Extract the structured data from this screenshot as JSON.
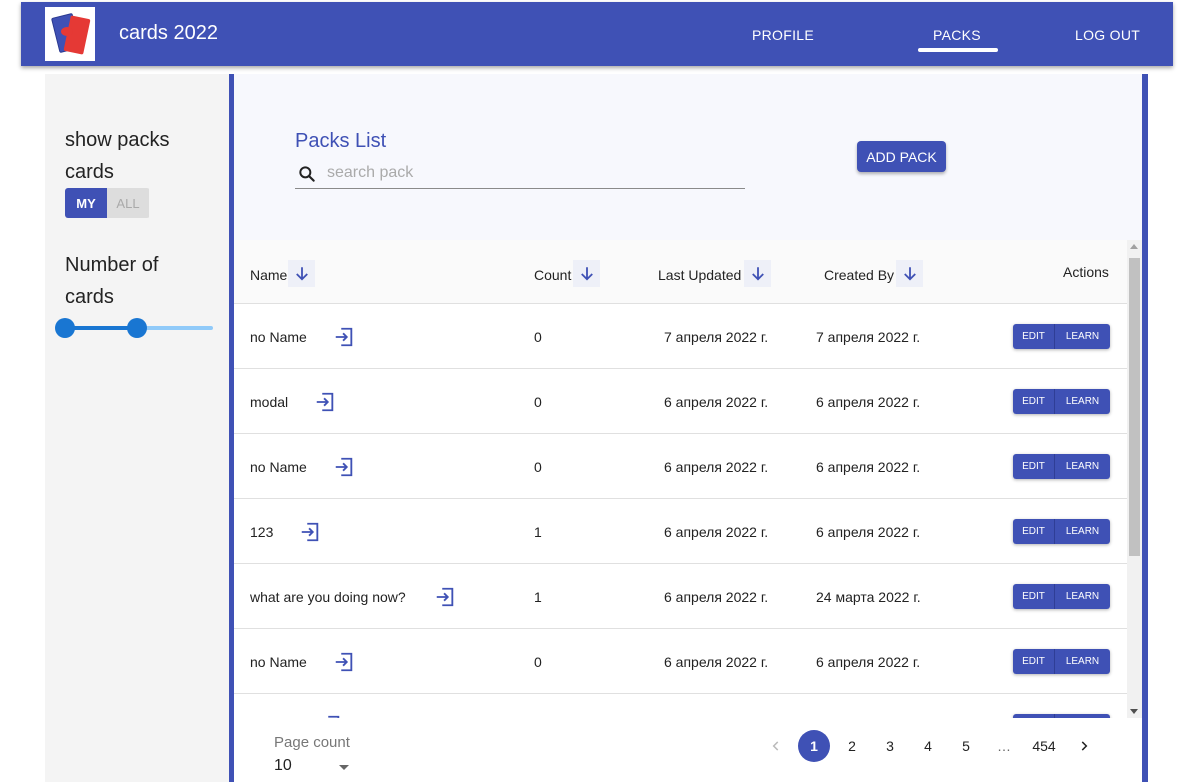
{
  "header": {
    "title": "cards 2022",
    "nav": [
      "PROFILE",
      "PACKS",
      "LOG OUT"
    ],
    "active_nav": "PACKS"
  },
  "sidebar": {
    "show_label_line1": "show packs",
    "show_label_line2": "cards",
    "toggle": {
      "my": "MY",
      "all": "ALL",
      "selected": "MY"
    },
    "number_label_line1": "Number of",
    "number_label_line2": "cards"
  },
  "main": {
    "title": "Packs List",
    "search_placeholder": "search pack",
    "search_value": "",
    "add_pack_label": "ADD PACK"
  },
  "table": {
    "headers": {
      "name": "Name",
      "count": "Count",
      "updated": "Last Updated",
      "created": "Created By",
      "actions": "Actions"
    },
    "edit_label": "EDIT",
    "learn_label": "LEARN",
    "rows": [
      {
        "name": "no Name",
        "count": "0",
        "updated": "7 апреля 2022 г.",
        "created": "7 апреля 2022 г."
      },
      {
        "name": "modal",
        "count": "0",
        "updated": "6 апреля 2022 г.",
        "created": "6 апреля 2022 г."
      },
      {
        "name": "no Name",
        "count": "0",
        "updated": "6 апреля 2022 г.",
        "created": "6 апреля 2022 г."
      },
      {
        "name": "123",
        "count": "1",
        "updated": "6 апреля 2022 г.",
        "created": "6 апреля 2022 г."
      },
      {
        "name": "what are you doing now?",
        "count": "1",
        "updated": "6 апреля 2022 г.",
        "created": "24 марта 2022 г."
      },
      {
        "name": "no Name",
        "count": "0",
        "updated": "6 апреля 2022 г.",
        "created": "6 апреля 2022 г."
      }
    ]
  },
  "footer": {
    "page_count_label": "Page count",
    "page_count_value": "10",
    "pages": [
      "1",
      "2",
      "3",
      "4",
      "5",
      "…",
      "454"
    ],
    "current_page": "1"
  },
  "colors": {
    "primary": "#3f51b5",
    "slider": "#1976d2",
    "slider_rail": "#90caf9"
  }
}
